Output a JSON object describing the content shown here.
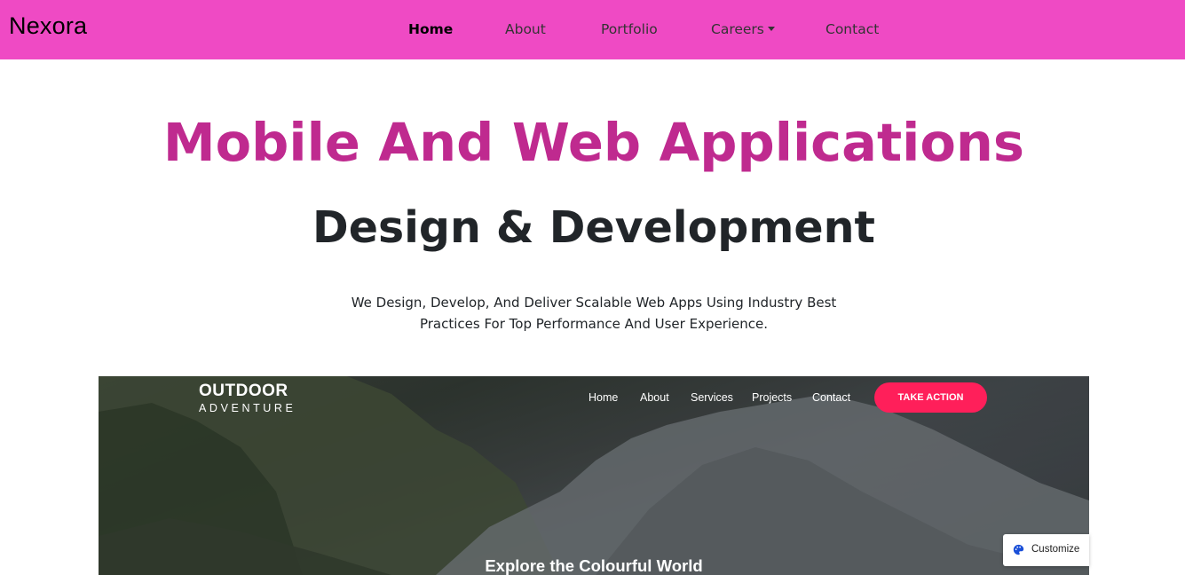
{
  "navbar": {
    "brand": "Nexora",
    "items": [
      {
        "label": "Home",
        "active": true
      },
      {
        "label": "About"
      },
      {
        "label": "Portfolio"
      },
      {
        "label": "Careers",
        "dropdown": true
      },
      {
        "label": "Contact"
      }
    ],
    "background": "#ef4ac4"
  },
  "hero": {
    "title": "Mobile And Web Applications",
    "subtitle": "Design & Development",
    "description": "We Design, Develop, And Deliver Scalable Web Apps Using Industry Best Practices For Top Performance And User Experience.",
    "title_color": "#bf2a8f"
  },
  "preview": {
    "logo_main": "OUTDOOR",
    "logo_sub": "ADVENTURE",
    "nav": [
      "Home",
      "About",
      "Services",
      "Projects",
      "Contact"
    ],
    "cta": "TAKE ACTION",
    "headline": "Explore the Colourful World",
    "cta_color": "#ff1f5a"
  },
  "customize": {
    "label": "Customize",
    "icon": "palette-icon"
  }
}
